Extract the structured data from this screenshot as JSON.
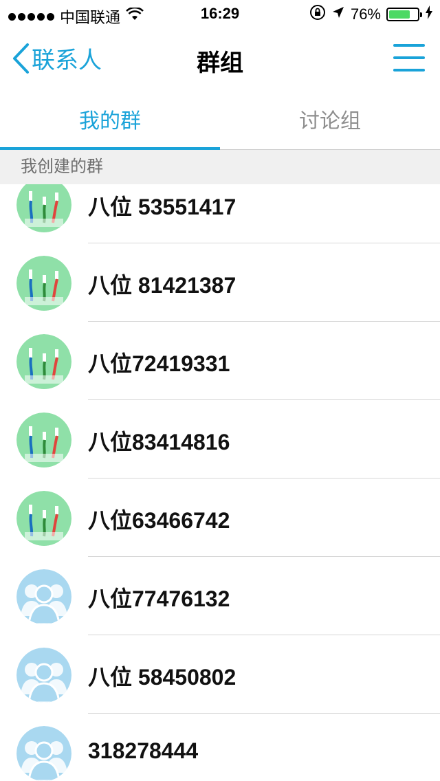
{
  "status_bar": {
    "carrier": "中国联通",
    "time": "16:29",
    "battery_percent": "76%",
    "battery_level": 0.76,
    "icons": [
      "wifi-icon",
      "rotation-lock-icon",
      "location-arrow-icon",
      "battery-icon",
      "charging-bolt-icon"
    ]
  },
  "nav": {
    "back_label": "联系人",
    "title": "群组",
    "menu_icon": "hamburger-menu-icon"
  },
  "tabs": [
    {
      "label": "我的群",
      "active": true
    },
    {
      "label": "讨论组",
      "active": false
    }
  ],
  "section_header": "我创建的群",
  "groups": [
    {
      "name": "八位 53551417",
      "avatar": "toothbrush"
    },
    {
      "name": "八位 81421387",
      "avatar": "toothbrush"
    },
    {
      "name": "八位72419331",
      "avatar": "toothbrush"
    },
    {
      "name": "八位83414816",
      "avatar": "toothbrush"
    },
    {
      "name": "八位63466742",
      "avatar": "toothbrush"
    },
    {
      "name": "八位77476132",
      "avatar": "people"
    },
    {
      "name": "八位 58450802",
      "avatar": "people"
    },
    {
      "name": "318278444",
      "avatar": "people"
    }
  ],
  "colors": {
    "accent": "#1aa3d9",
    "toothbrush_avatar_bg": "#8fe0a8",
    "people_avatar_bg": "#a9d8f0"
  }
}
